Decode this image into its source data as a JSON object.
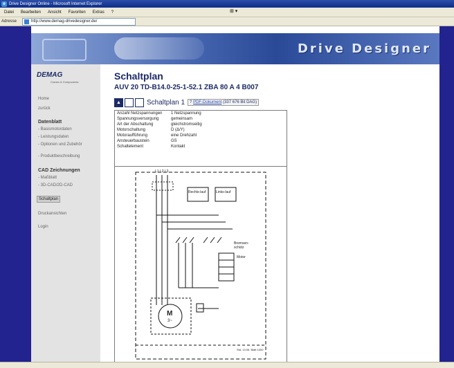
{
  "browser": {
    "title": "Drive Designer Online - Microsoft Internet Explorer",
    "menu": [
      "Datei",
      "Bearbeiten",
      "Ansicht",
      "Favoriten",
      "Extras",
      "?"
    ],
    "address_label": "Adresse",
    "address_value": "http://www.demag-drivedesigner.de/"
  },
  "banner": {
    "title": "Drive Designer"
  },
  "sidebar": {
    "logo": "DEMAG",
    "logo_sub": "Cranes & Components",
    "items": [
      "Home",
      "zurück"
    ],
    "section1_head": "Datenblatt",
    "section1_items": [
      "Basismotordaten",
      "Leistungsdaten",
      "Optionen und Zubehör",
      "Produktbeschreibung"
    ],
    "cad_head": "CAD Zeichnungen",
    "cad_items": [
      "Maßblatt",
      "3D-CAD/2D-CAD"
    ],
    "selected": "Schaltplan",
    "extra_items": [
      "Druckansichten",
      "Login"
    ]
  },
  "main": {
    "title": "Schaltplan",
    "subtitle": "AUV 20 TD-B14.0-25-1-52.1 ZBA 80 A 4 B007",
    "tab_label": "Schaltplan 1",
    "pdf_label": "PDF-Dokument",
    "pdf_size": "(337 676 Bit DAG)"
  },
  "info": [
    {
      "k": "Anzahl Netzspannungen",
      "v": "1 Netzspannung"
    },
    {
      "k": "Spannungsversorgung",
      "v": "gemeinsam"
    },
    {
      "k": "Art der Abschaltung",
      "v": "gleichstromseitig"
    },
    {
      "k": "Motorschaltung",
      "v": "D (Δ/Y)"
    },
    {
      "k": "Motoraufführung",
      "v": "eine Drehzahl"
    },
    {
      "k": "Ansteuerbaustein",
      "v": "GS"
    },
    {
      "k": "Schaltelement",
      "v": "Kontakt"
    }
  ],
  "diagram_labels": {
    "top_left": "L1 L2 L3",
    "relay1": "Rechts-lauf",
    "relay2": "Links-lauf",
    "right1": "Bremsen-schütz",
    "right2": "Motor",
    "motor": "M",
    "motor_sub": "3~",
    "footer": "Std. 13.06. Blatt 1000"
  }
}
